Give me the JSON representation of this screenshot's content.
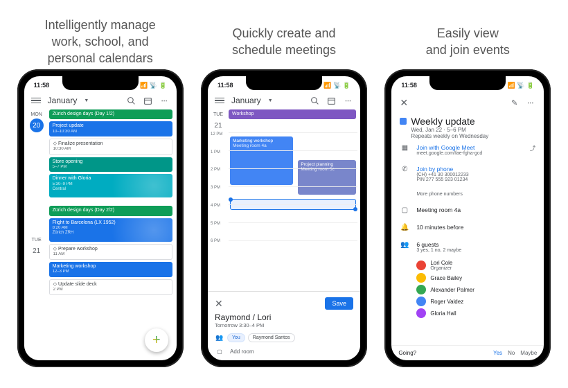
{
  "status_time": "11:58",
  "captions": [
    "Intelligently manage\nwork, school, and\npersonal calendars",
    "Quickly create and\nschedule meetings",
    "Easily view\nand join events"
  ],
  "header": {
    "month": "January"
  },
  "screen1": {
    "day1": {
      "label": "MON",
      "num": "20"
    },
    "events1": [
      {
        "title": "Zürich design days (Day 1/2)",
        "sub": "",
        "color": "#0f9d58"
      },
      {
        "title": "Project update",
        "sub": "10–10:30 AM",
        "color": "#1a73e8"
      },
      {
        "title": "◇ Finalize presentation",
        "sub": "10:30 AM",
        "color": "#ffffff",
        "text": "#3c4043",
        "border": true
      },
      {
        "title": "Store opening",
        "sub": "5–7 PM",
        "color": "#009688"
      },
      {
        "title": "Dinner with Gloria",
        "sub": "5:30–9 PM\nCentral",
        "color": "#00acc1",
        "deco": true
      }
    ],
    "day2": {
      "label": "TUE",
      "num": "21"
    },
    "events2": [
      {
        "title": "Zürich design days (Day 2/2)",
        "sub": "",
        "color": "#0f9d58"
      },
      {
        "title": "Flight to Barcelona (LX 1952)",
        "sub": "8:20 AM\nZürich ZRH",
        "color": "#1a73e8",
        "deco": true
      },
      {
        "title": "◇ Prepare workshop",
        "sub": "11 AM",
        "color": "#ffffff",
        "text": "#3c4043",
        "border": true
      },
      {
        "title": "Marketing workshop",
        "sub": "12–3 PM",
        "color": "#1a73e8"
      },
      {
        "title": "◇ Update slide deck",
        "sub": "2 PM",
        "color": "#ffffff",
        "text": "#3c4043",
        "border": true
      }
    ]
  },
  "screen2": {
    "day": {
      "label": "TUE",
      "num": "21"
    },
    "allday": {
      "title": "Workshop",
      "color": "#7e57c2"
    },
    "hours": [
      "12 PM",
      "1 PM",
      "2 PM",
      "3 PM",
      "4 PM",
      "5 PM",
      "6 PM"
    ],
    "blocks": [
      {
        "title": "Marketing workshop",
        "sub": "Meeting room 4a",
        "color": "#4285f4"
      },
      {
        "title": "Project planning",
        "sub": "Meeting room 5c",
        "color": "#7986cb"
      }
    ],
    "sheet": {
      "save": "Save",
      "title": "Raymond / Lori",
      "subtitle": "Tomorrow    3:30–4 PM",
      "chip_you": "You",
      "chip_other": "Raymond Santos",
      "add_room": "Add room"
    }
  },
  "screen3": {
    "title": "Weekly update",
    "date": "Wed, Jan 22 · 5–6 PM",
    "repeat": "Repeats weekly on Wednesday",
    "meet_label": "Join with Google Meet",
    "meet_url": "meet.google.com/fae-fgha-gcd",
    "phone_label": "Join by phone",
    "phone_num": "(CH) +41 30 300012233",
    "phone_pin": "PIN 277 555 923 01234",
    "more_phone": "More phone numbers",
    "room": "Meeting room 4a",
    "reminder": "10 minutes before",
    "guests_count": "6 guests",
    "guests_sub": "3 yes, 1 no, 2 maybe",
    "guests": [
      {
        "name": "Lori Cole",
        "sub": "Organizer",
        "color": "#ea4335"
      },
      {
        "name": "Grace Bailey",
        "color": "#fbbc04"
      },
      {
        "name": "Alexander Palmer",
        "color": "#34a853"
      },
      {
        "name": "Roger Valdez",
        "color": "#4285f4"
      },
      {
        "name": "Gloria Hall",
        "color": "#a142f4"
      }
    ],
    "going": {
      "label": "Going?",
      "yes": "Yes",
      "no": "No",
      "maybe": "Maybe"
    }
  }
}
